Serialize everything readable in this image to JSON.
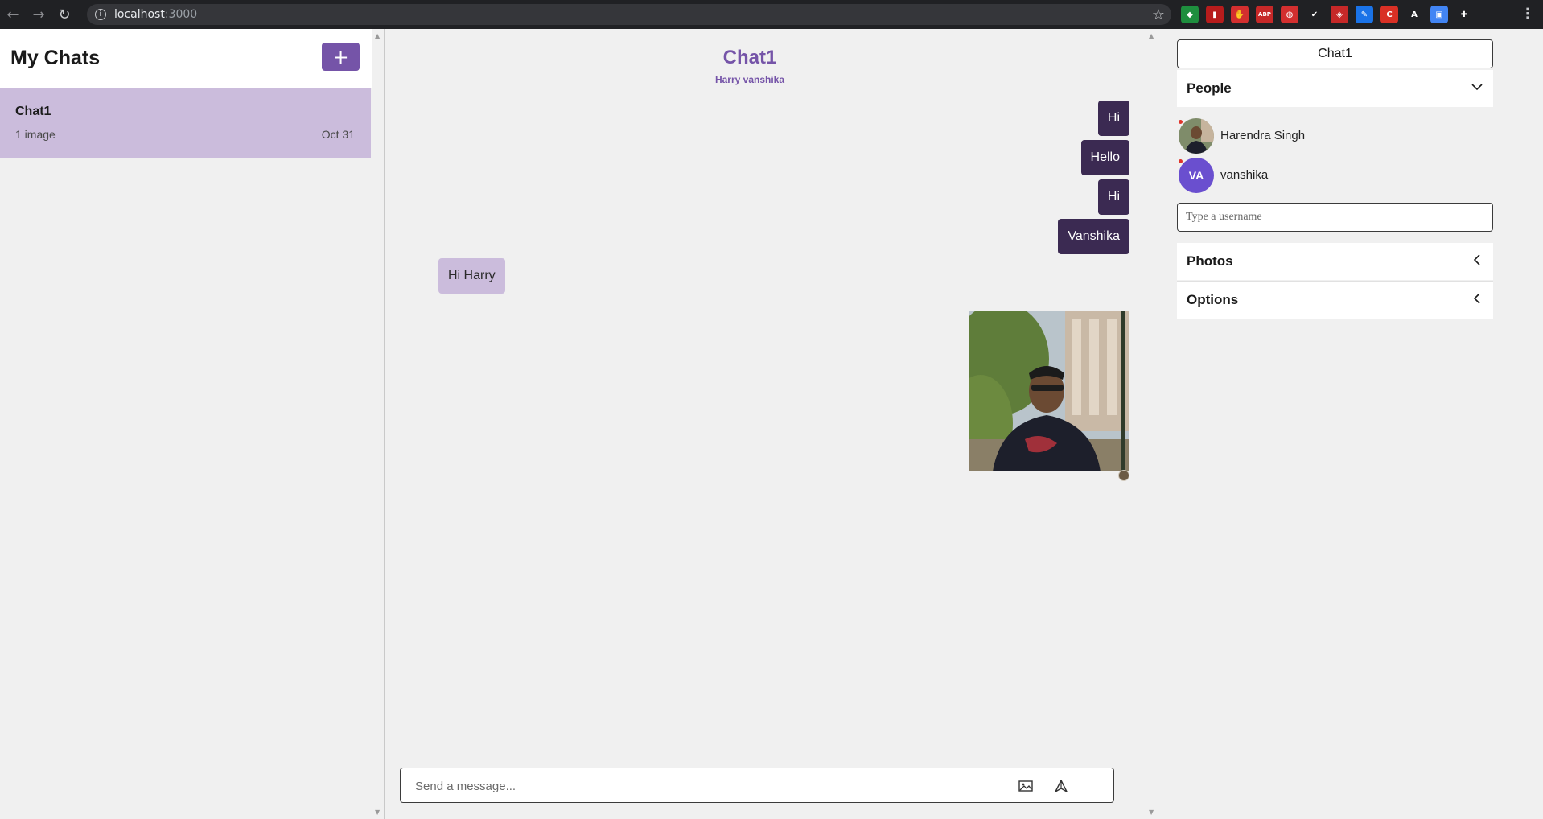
{
  "browser": {
    "url_host": "localhost",
    "url_port": ":3000",
    "extensions": [
      {
        "name": "shield-ext",
        "color": "#1e8e3e",
        "glyph": "◆"
      },
      {
        "name": "chart-ext",
        "color": "#b71c1c",
        "glyph": "▮"
      },
      {
        "name": "hand-ext",
        "color": "#d32f2f",
        "glyph": "✋"
      },
      {
        "name": "abp-ext",
        "color": "#c62828",
        "glyph": "ABP"
      },
      {
        "name": "pocket-ext",
        "color": "#d32f2f",
        "glyph": "◍"
      },
      {
        "name": "check-ext",
        "color": "#202124",
        "glyph": "✔"
      },
      {
        "name": "camera-ext",
        "color": "#c62828",
        "glyph": "◈"
      },
      {
        "name": "pen-ext",
        "color": "#1a73e8",
        "glyph": "✎"
      },
      {
        "name": "ct-ext",
        "color": "#d93025",
        "glyph": "C"
      },
      {
        "name": "a-ext",
        "color": "#202124",
        "glyph": "A"
      },
      {
        "name": "screen-ext",
        "color": "#4285f4",
        "glyph": "▣"
      },
      {
        "name": "puzzle-ext",
        "color": "#202124",
        "glyph": "✚"
      }
    ]
  },
  "sidebar": {
    "title": "My Chats",
    "new_chat_label": "+",
    "chats": [
      {
        "title": "Chat1",
        "last_message": "1 image",
        "date": "Oct 31"
      }
    ]
  },
  "chat": {
    "title": "Chat1",
    "people": "Harry vanshika",
    "messages": [
      {
        "text": "Hi",
        "direction": "out"
      },
      {
        "text": "Hello",
        "direction": "out"
      },
      {
        "text": "Hi",
        "direction": "out"
      },
      {
        "text": "Vanshika",
        "direction": "out"
      },
      {
        "text": "Hi Harry",
        "direction": "in"
      }
    ],
    "composer_placeholder": "Send a message..."
  },
  "settings": {
    "chat_title": "Chat1",
    "people_label": "People",
    "people": [
      {
        "name": "Harendra Singh",
        "initials": "",
        "has_photo": true
      },
      {
        "name": "vanshika",
        "initials": "VA",
        "has_photo": false
      }
    ],
    "username_placeholder": "Type a username",
    "photos_label": "Photos",
    "options_label": "Options"
  },
  "colors": {
    "accent": "#7554a8",
    "outgoing_bubble": "#3b2a52",
    "incoming_bubble": "#cbbcdc",
    "selected_chat": "#cbbcdc",
    "avatar_va": "#6a4fcf"
  }
}
